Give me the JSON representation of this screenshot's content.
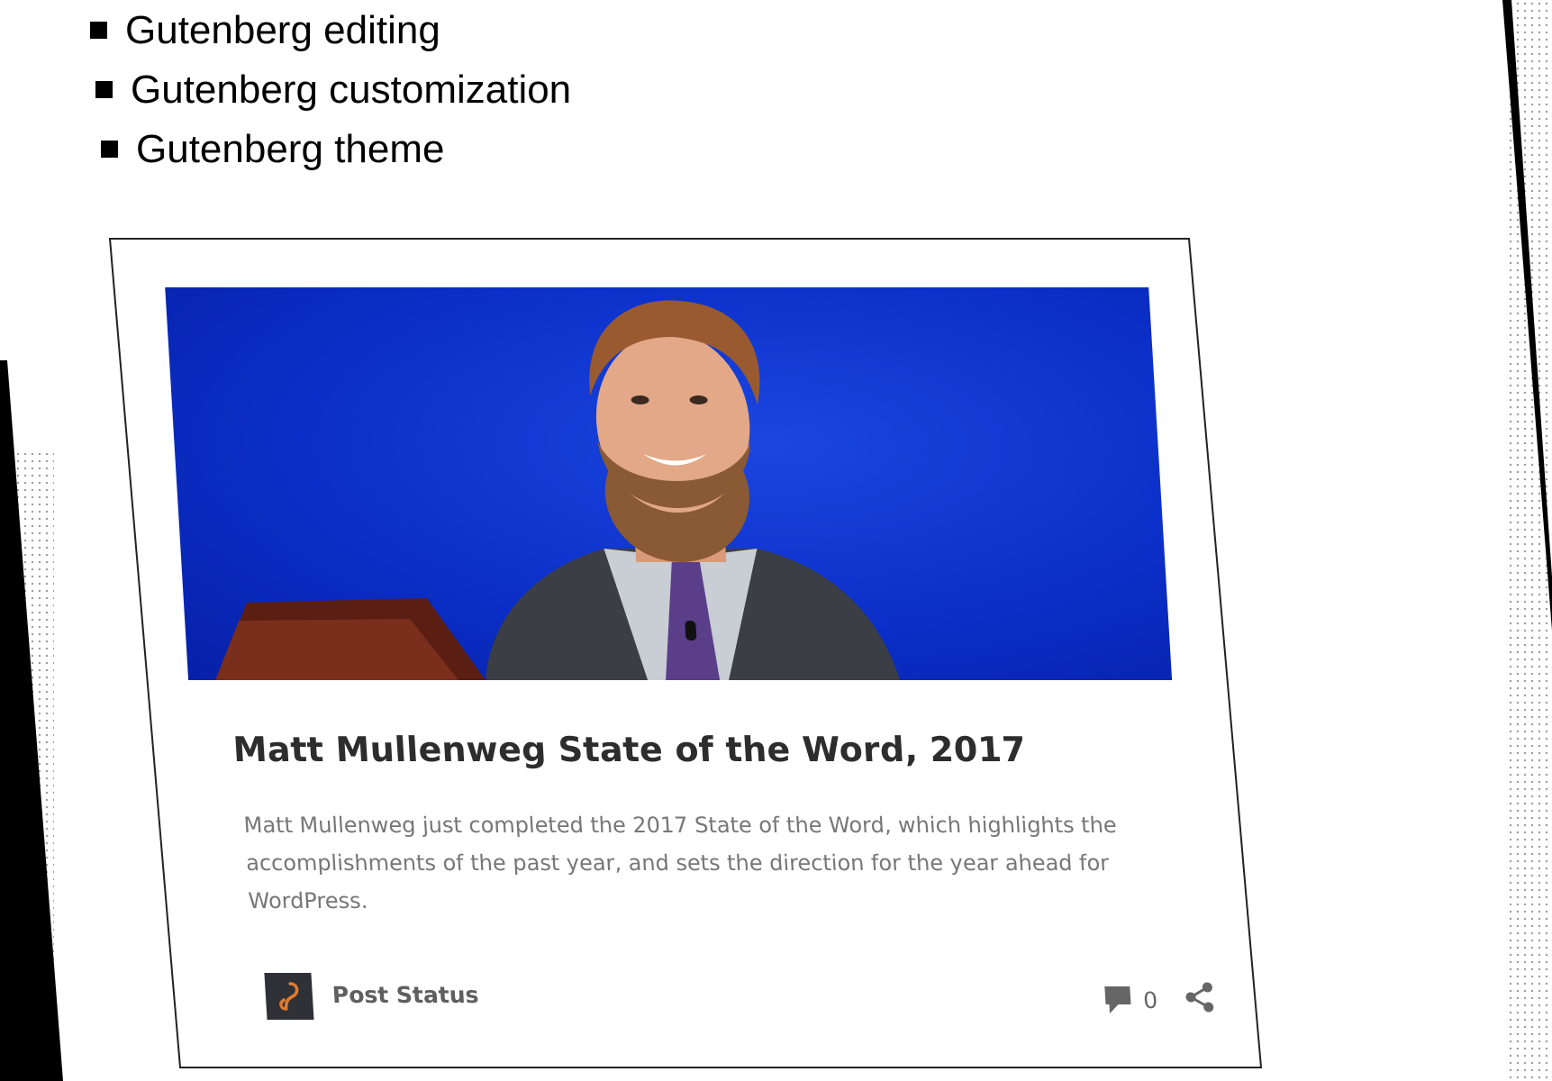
{
  "bullets": [
    "Gutenberg editing",
    "Gutenberg customization",
    "Gutenberg theme"
  ],
  "card": {
    "title": "Matt Mullenweg State of the Word, 2017",
    "excerpt": "Matt Mullenweg just completed the 2017 State of the Word, which highlights the accomplishments of the past year, and sets the direction for the year ahead for WordPress.",
    "author": "Post Status",
    "comment_count": "0"
  },
  "icons": {
    "avatar": "post-status-logo-icon",
    "comments": "comment-bubble-icon",
    "share": "share-icon"
  },
  "colors": {
    "hero_background": "#0b2fc8",
    "avatar_background": "#2f3136",
    "avatar_mark": "#e07a2e",
    "title_text": "#2d2d2d",
    "excerpt_text": "#777777"
  }
}
